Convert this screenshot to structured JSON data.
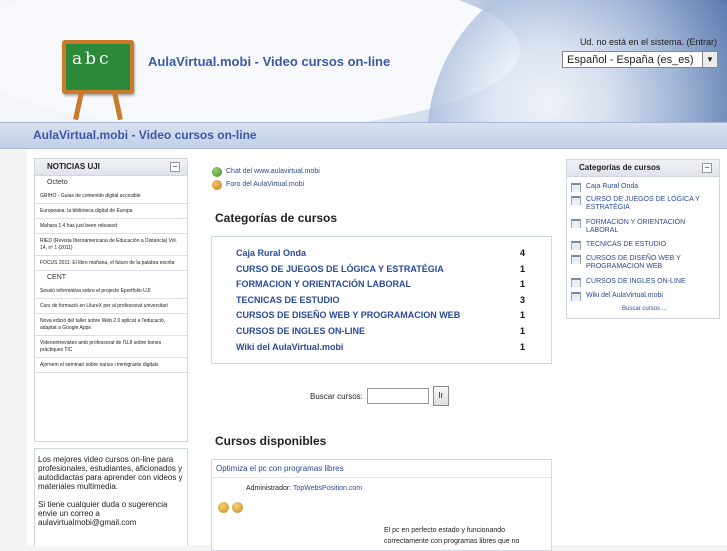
{
  "header": {
    "site_title": "AulaVirtual.mobi - Video cursos on-line",
    "login_info": "Ud. no está en el sistema. (Entrar)",
    "language": "Español - España (es_es)"
  },
  "navbar": {
    "breadcrumb": "AulaVirtual.mobi - Video cursos on-line"
  },
  "news_block": {
    "title": "NOTICIAS UJI",
    "groups": [
      {
        "name": "Octeto",
        "items": [
          "GRIHO - Guias de contenido digital accesible",
          "Europeana: la biblioteca digital de Europa",
          "Mahara 1.4 has just been released",
          "RIED (Revista Iberoamericana de Educación a Distancia) Vol. 14, nº 1 (2011)",
          "FOCUS 2011: El libro mañana, el futuro de la palabra escrita"
        ]
      },
      {
        "name": "CENT",
        "items": [
          "Sessió informativa sobre el projecte Eportfolio UJI",
          "Curs de formació en LliureX per al professorat universitari",
          "Nova edició del taller sobre Web 2.0 aplicat a l'educació, adaptat a Google Apps",
          "Videoentrevistes amb professorat de l'UJI sobre bones pràctiques TIC",
          "Ajornem el seminari sobre narius i immigrants digitals"
        ]
      }
    ]
  },
  "left_info": {
    "paragraph1": "Los mejores video cursos on-line para profesionales, estudiantes, aficionados y autodidactas para aprender con videos y materiales multimedia.",
    "paragraph2": "Si tiene cualquier duda o sugerencia envie un correo a aulavirtualmobi@gmail.com"
  },
  "top_links": {
    "chat": "Chat del www.aulavirtual.mobi",
    "forum": "Foro del AulaVirtual.mobi"
  },
  "categories": {
    "heading": "Categorías de cursos",
    "items": [
      {
        "name": "Caja Rural Onda",
        "count": "4"
      },
      {
        "name": "CURSO DE JUEGOS DE LÓGICA Y ESTRATÉGIA",
        "count": "1"
      },
      {
        "name": "FORMACION Y ORIENTACIÓN LABORAL",
        "count": "1"
      },
      {
        "name": "TECNICAS DE ESTUDIO",
        "count": "3"
      },
      {
        "name": "CURSOS DE DISEÑO WEB Y PROGRAMACION WEB",
        "count": "1"
      },
      {
        "name": "CURSOS DE INGLES ON-LINE",
        "count": "1"
      },
      {
        "name": "Wiki del AulaVirtual.mobi",
        "count": "1"
      }
    ]
  },
  "search": {
    "label": "Buscar cursos:",
    "button": "Ir"
  },
  "courses": {
    "heading": "Cursos disponibles",
    "course_title": "Optimiza el pc con programas libres",
    "admin_label": "Administrador:",
    "admin_name": "TopWebsPosition.com",
    "summary": "El pc en perfecto estado y funcionando correctamente con programas libres que no"
  },
  "right_block": {
    "title": "Categorías de cursos",
    "items": [
      "Caja Rural Onda",
      "CURSO DE JUEGOS DE LÓGICA Y ESTRATÉGIA",
      "FORMACION Y ORIENTACIÓN LABORAL",
      "TECNICAS DE ESTUDIO",
      "CURSOS DE DISEÑO WEB Y PROGRAMACION WEB",
      "CURSOS DE INGLES ON-LINE",
      "Wiki del AulaVirtual.mobi"
    ],
    "more": "Buscar cursos ..."
  }
}
